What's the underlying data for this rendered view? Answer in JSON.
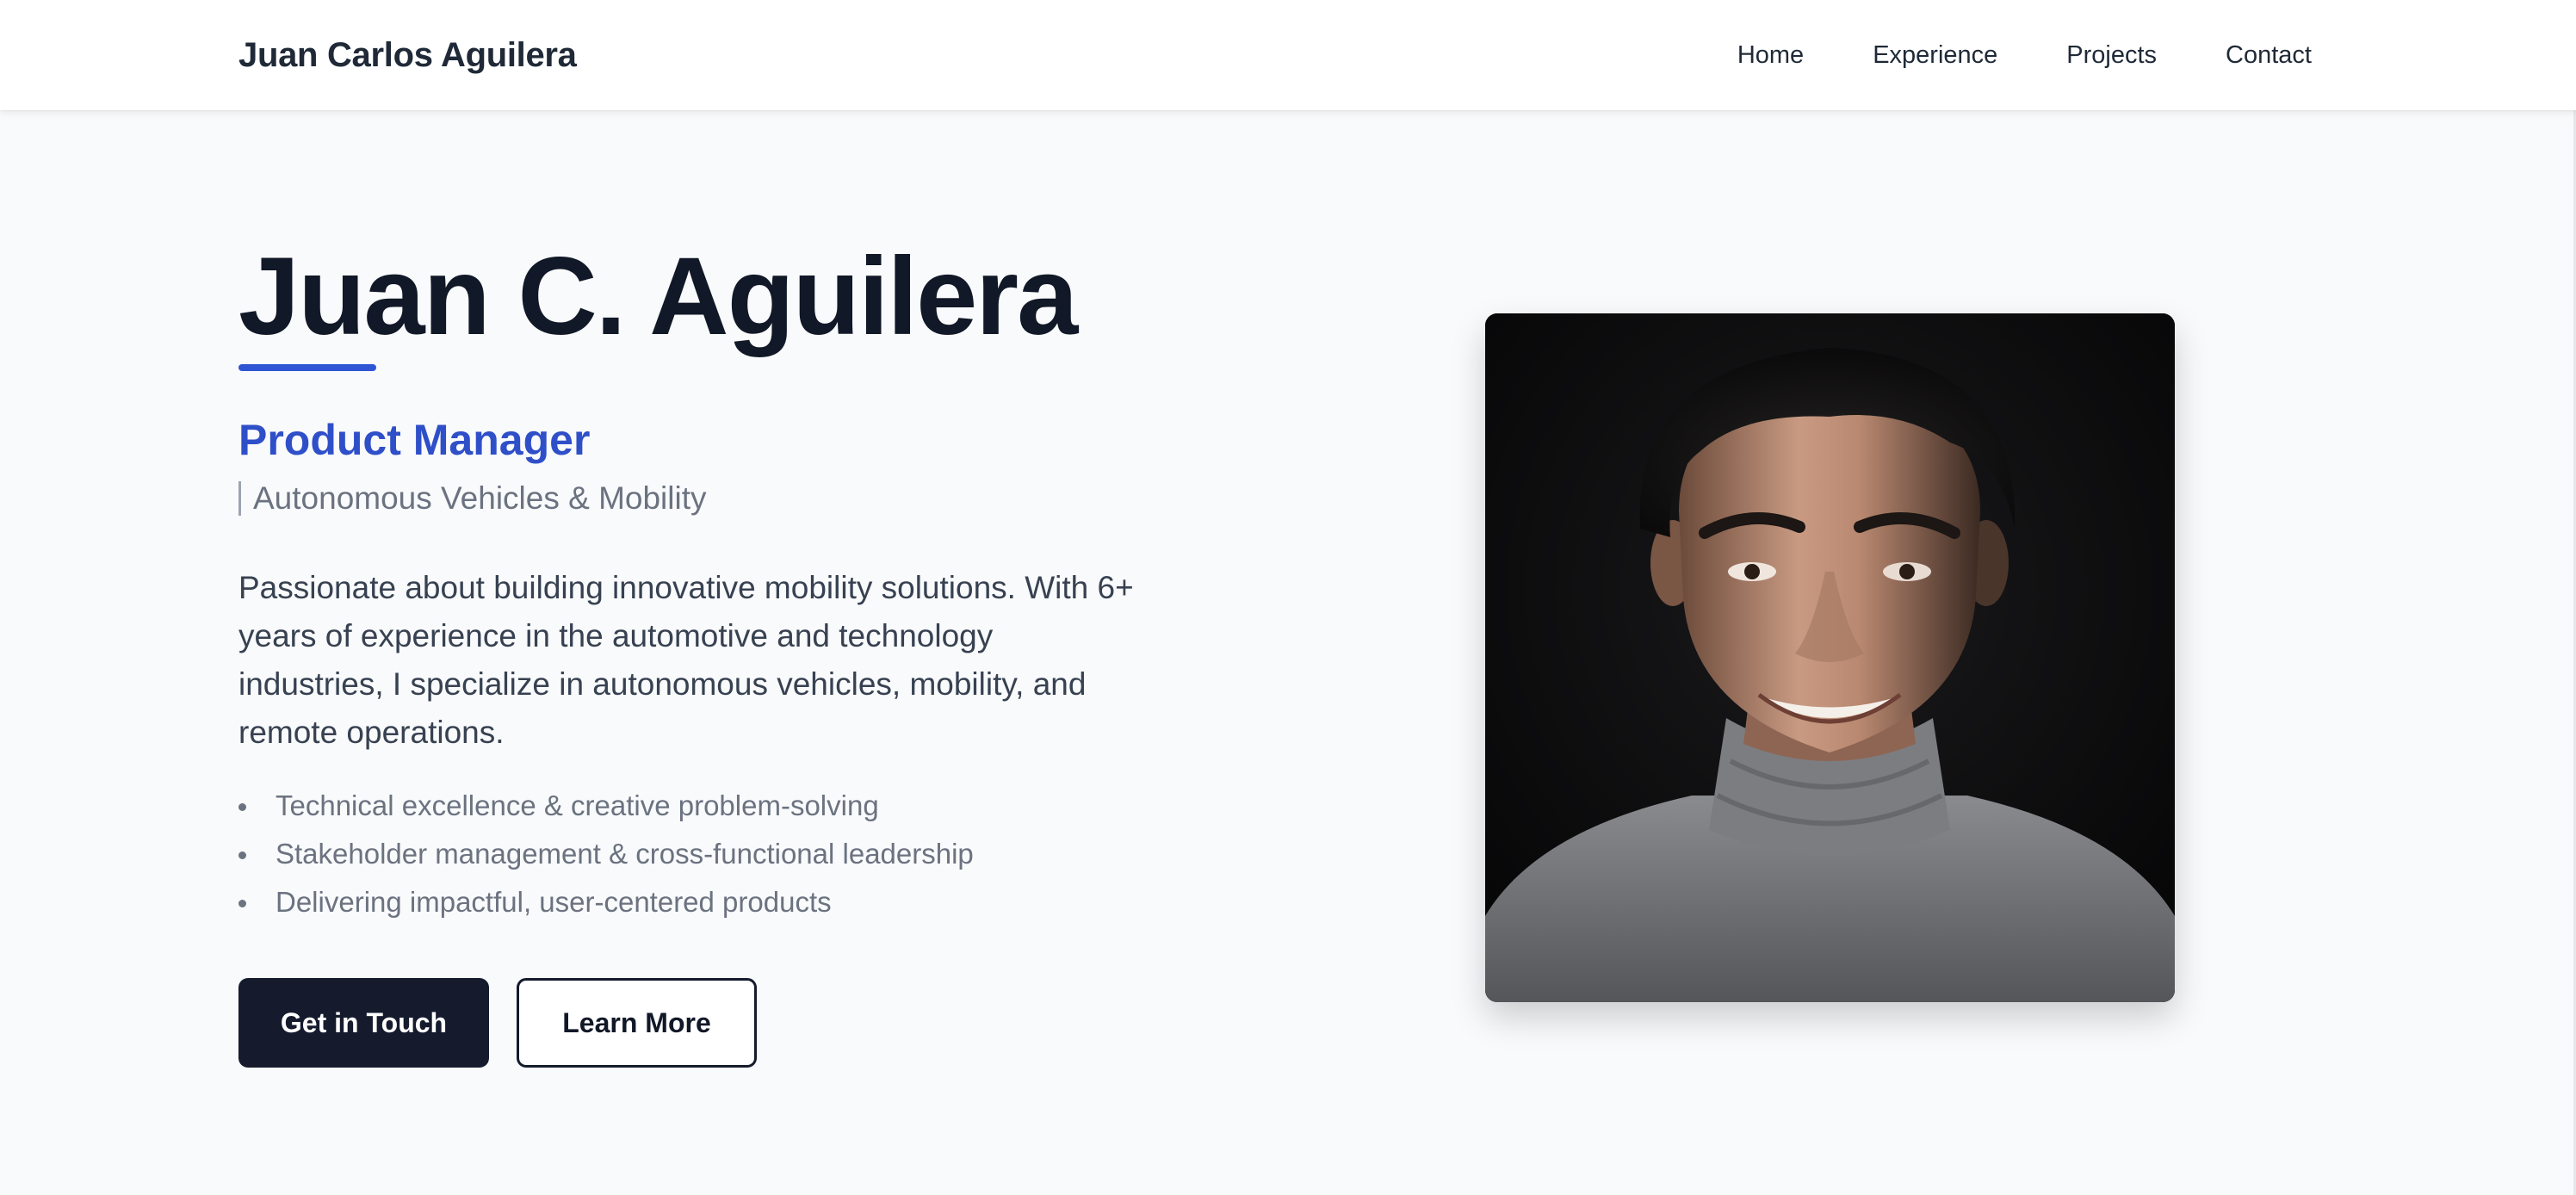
{
  "header": {
    "brand": "Juan Carlos Aguilera",
    "nav": [
      "Home",
      "Experience",
      "Projects",
      "Contact"
    ]
  },
  "hero": {
    "name": "Juan C. Aguilera",
    "role": "Product Manager",
    "subtitle": "Autonomous Vehicles & Mobility",
    "bio": "Passionate about building innovative mobility solutions. With 6+ years of experience in the automotive and technology industries, I specialize in autonomous vehicles, mobility, and remote operations.",
    "highlights": [
      "Technical excellence & creative problem-solving",
      "Stakeholder management & cross-functional leadership",
      "Delivering impactful, user-centered products"
    ],
    "primary_cta": "Get in Touch",
    "secondary_cta": "Learn More"
  },
  "colors": {
    "accent": "#2f4fc9",
    "dark": "#151b2d",
    "text_muted": "#6b7280"
  }
}
